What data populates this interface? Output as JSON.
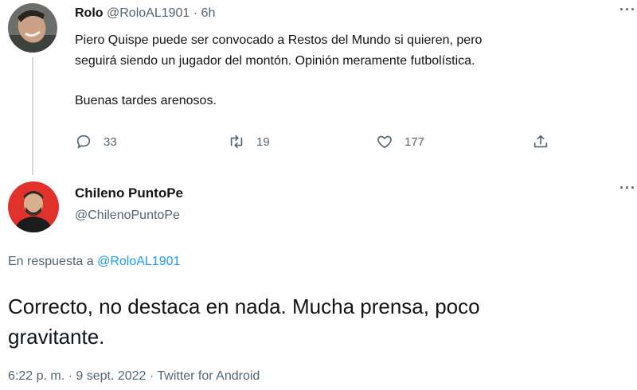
{
  "tweet1": {
    "name": "Rolo",
    "handle": "@RoloAL1901",
    "time": "6h",
    "more_icon": "more-horizontal-icon",
    "lines": [
      "Piero Quispe puede ser convocado a Restos del Mundo si quieren, pero",
      "seguirá siendo un jugador del montón. Opinión meramente futbolística.",
      "Buenas tardes arenosos."
    ],
    "actions": {
      "reply_count": "33",
      "retweet_count": "19",
      "like_count": "177"
    }
  },
  "tweet2": {
    "name": "Chileno PuntoPe",
    "handle": "@ChilenoPuntoPe",
    "reply_prefix": "En respuesta a",
    "reply_handle": "@RoloAL1901",
    "text_line1": "Correcto, no destaca en nada. Mucha prensa, poco",
    "text_line2": "gravitante.",
    "footer": "6:22 p. m. · 9 sept. 2022 · Twitter for Android"
  },
  "colors": {
    "link": "#1d9bf0",
    "secondary_text": "#536471",
    "primary_text": "#0f1419",
    "avatar2_bg": "#e0322b"
  }
}
